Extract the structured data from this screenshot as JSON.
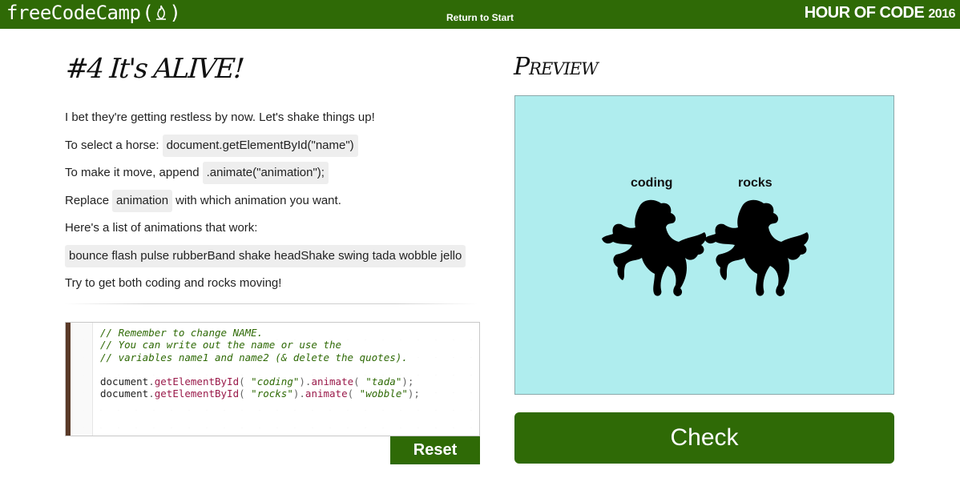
{
  "header": {
    "brand": "freeCodeCamp",
    "return_link": "Return to Start",
    "event_title": "HOUR OF CODE",
    "event_year": "2016"
  },
  "lesson": {
    "title": "#4 It's ALIVE!",
    "intro": "I bet they're getting restless by now. Let's shake things up!",
    "select_label": "To select a horse:",
    "select_code": "document.getElementById(\"name\")",
    "move_label": "To make it move, append",
    "move_code": ".animate(\"animation\");",
    "replace_label": "Replace",
    "replace_code": "animation",
    "replace_suffix": "with which animation you want.",
    "list_label": "Here's a list of animations that work:",
    "animations": "bounce flash pulse rubberBand shake headShake swing tada wobble jello",
    "goal": "Try to get both coding and rocks moving!"
  },
  "editor": {
    "comment1": "// Remember to change NAME.",
    "comment2": "// You can write out the name or use the",
    "comment3": "// variables name1 and name2 (& delete the quotes).",
    "obj": "document",
    "method1": "getElementById",
    "method2": "animate",
    "line1_id": "\"coding\"",
    "line1_anim": "\"tada\"",
    "line2_id": "\"rocks\"",
    "line2_anim": "\"wobble\"",
    "reset_label": "Reset"
  },
  "preview": {
    "title": "Preview",
    "background": "#afedee",
    "horses": [
      {
        "name": "coding"
      },
      {
        "name": "rocks"
      }
    ]
  },
  "check_label": "Check",
  "colors": {
    "brand_green": "#2f6a06",
    "preview_bg": "#afedee"
  }
}
